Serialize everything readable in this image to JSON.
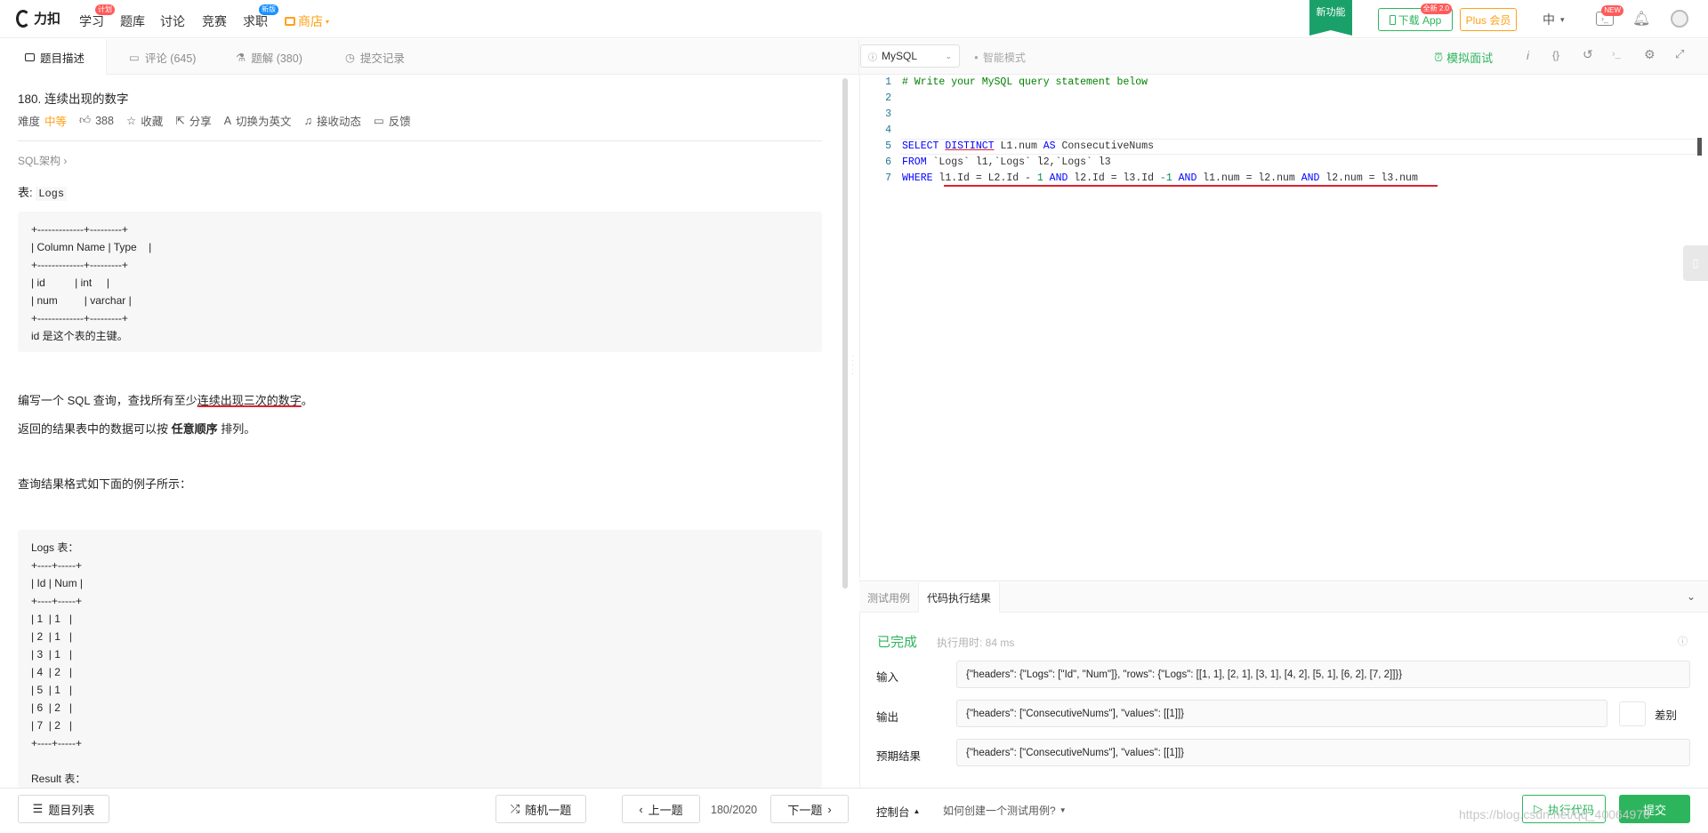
{
  "nav": {
    "logo": "力扣",
    "items": [
      {
        "label": "学习",
        "badge": "计划",
        "badge_color": "#ff5b5b"
      },
      {
        "label": "题库"
      },
      {
        "label": "讨论"
      },
      {
        "label": "竞赛"
      },
      {
        "label": "求职",
        "badge": "新版",
        "badge_color": "#1890ff"
      },
      {
        "label": "商店"
      }
    ],
    "new_feature": "新功能",
    "download": "下载 App",
    "download_badge": "全新 2.0",
    "plus": "Plus 会员",
    "lang": "中",
    "notify_badge": "NEW"
  },
  "left_tabs": [
    "题目描述",
    "评论 (645)",
    "题解 (380)",
    "提交记录"
  ],
  "problem": {
    "title": "180. 连续出现的数字",
    "difficulty_label": "难度",
    "difficulty": "中等",
    "likes": "388",
    "favorite": "收藏",
    "share": "分享",
    "switch_lang": "切换为英文",
    "subscribe": "接收动态",
    "feedback": "反馈",
    "breadcrumb": "SQL架构 ›",
    "table_prefix": "表:",
    "table_name": "Logs",
    "schema_block": "+-------------+---------+\n| Column Name | Type    |\n+-------------+---------+\n| id          | int     |\n| num         | varchar |\n+-------------+---------+\nid 是这个表的主键。",
    "desc1_pre": "编写一个 SQL 查询，查找所有至少",
    "desc1_emph": "连续出现三次的数字",
    "desc1_post": "。",
    "desc2_pre": "返回的结果表中的数据可以按 ",
    "desc2_bold": "任意顺序",
    "desc2_post": " 排列。",
    "desc3": "查询结果格式如下面的例子所示：",
    "example_block": "Logs 表：\n+----+-----+\n| Id | Num |\n+----+-----+\n| 1  | 1   |\n| 2  | 1   |\n| 3  | 1   |\n| 4  | 2   |\n| 5  | 1   |\n| 6  | 2   |\n| 7  | 2   |\n+----+-----+\n\nResult 表："
  },
  "editor": {
    "language": "MySQL",
    "smart_mode": "智能模式",
    "mock_interview": "模拟面试",
    "lines": [
      "1",
      "2",
      "3",
      "4",
      "5",
      "6",
      "7"
    ],
    "line1": "# Write your MySQL query statement below",
    "l5": {
      "a": "SELECT",
      "b": "DISTINCT",
      "c": " L1.num ",
      "d": "AS",
      "e": " ConsecutiveNums"
    },
    "l6": {
      "a": "FROM",
      "b": " `Logs` l1,`Logs` l2,`Logs` l3"
    },
    "l7": {
      "a": "WHERE",
      "b": " l1.Id ",
      "c": "=",
      "d": " L2.Id ",
      "e": "-",
      "f": " 1 ",
      "g": "AND",
      "h": " l2.Id ",
      "i": "=",
      "j": " l3.Id ",
      "k": "-1",
      "l": " AND",
      "m": " l1.num ",
      "n": "=",
      "o": " l2.num ",
      "p": "AND",
      "q": " l2.num ",
      "r": "=",
      "s": " l3.num"
    }
  },
  "result": {
    "tabs": [
      "测试用例",
      "代码执行结果"
    ],
    "status": "已完成",
    "time": "执行用时: 84 ms",
    "input_label": "输入",
    "input": "{\"headers\": {\"Logs\": [\"Id\", \"Num\"]}, \"rows\": {\"Logs\": [[1, 1], [2, 1], [3, 1], [4, 2], [5, 1], [6, 2], [7, 2]]}}",
    "output_label": "输出",
    "output": "{\"headers\": [\"ConsecutiveNums\"], \"values\": [[1]]}",
    "diff": "差别",
    "expected_label": "预期结果",
    "expected": "{\"headers\": [\"ConsecutiveNums\"], \"values\": [[1]]}"
  },
  "bottom": {
    "problem_list": "题目列表",
    "random": "随机一题",
    "prev": "上一题",
    "page": "180/2020",
    "next": "下一题",
    "console": "控制台",
    "howto": "如何创建一个测试用例?",
    "run": "执行代码",
    "submit": "提交",
    "watermark": "https://blog.csdn.net/qq_40064976"
  }
}
